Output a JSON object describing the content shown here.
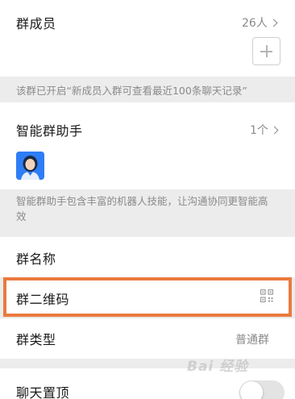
{
  "group_members": {
    "title": "群成员",
    "count": "26人"
  },
  "history_note": "该群已开启“新成员入群可查看最近100条聊天记录”",
  "assistant": {
    "title": "智能群助手",
    "count": "1个",
    "note_line1": "智能群助手包含丰富的机器人技能，让沟通协同更智能高",
    "note_line2": "效"
  },
  "settings": {
    "group_name": "群名称",
    "group_qr": "群二维码",
    "group_type": "群类型",
    "group_type_value": "普通群",
    "pin_chat": "聊天置顶",
    "pin_chat_on": false
  },
  "watermark": "Bai 经验",
  "colors": {
    "highlight": "#ea7a3d",
    "avatar_bg": "#2f7df6"
  }
}
